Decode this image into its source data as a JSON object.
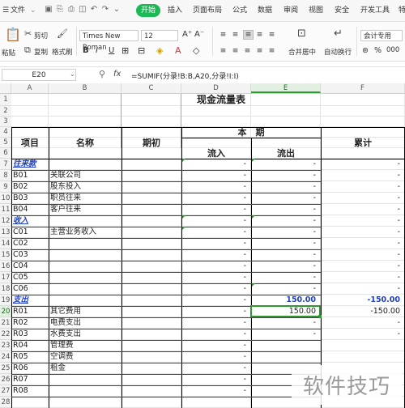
{
  "menu": {
    "file_label": "文件",
    "tabs": [
      "开始",
      "插入",
      "页面布局",
      "公式",
      "数据",
      "审阅",
      "视图",
      "安全",
      "开发工具",
      "特"
    ]
  },
  "ribbon": {
    "paste": "粘贴",
    "cut": "剪切",
    "copy": "复制",
    "format_painter": "格式刷",
    "font_name": "Times New Roman",
    "font_size": "12",
    "merge_center": "合并居中",
    "wrap_text": "自动换行",
    "number_format": "会计专用",
    "percent": "%",
    "thousands": "000"
  },
  "formula_bar": {
    "cell_ref": "E20",
    "fx": "fx",
    "formula": "=SUMIF(分录!B:B,A20,分录!I:I)"
  },
  "columns": [
    "A",
    "B",
    "C",
    "D",
    "E",
    "F"
  ],
  "selected_column": "E",
  "rows": [
    "1",
    "2",
    "3",
    "4",
    "5",
    "6",
    "7",
    "8",
    "9",
    "10",
    "11",
    "12",
    "13",
    "14",
    "15",
    "16",
    "17",
    "18",
    "19",
    "20",
    "21",
    "22",
    "23",
    "24",
    "25",
    "26",
    "27",
    "28"
  ],
  "selected_row": "20",
  "sheet": {
    "title": "现金流量表",
    "header": {
      "item": "项目",
      "name": "名称",
      "opening": "期初",
      "current_period": "本　期",
      "inflow": "流入",
      "outflow": "流出",
      "cumulative": "累计"
    },
    "data_rows": [
      {
        "code": "往来款",
        "name": "",
        "section": true,
        "d": "-",
        "e": "-",
        "f": "-"
      },
      {
        "code": "B01",
        "name": "关联公司",
        "d": "-",
        "e": "-",
        "f": "-"
      },
      {
        "code": "B02",
        "name": "股东投入",
        "d": "-",
        "e": "-",
        "f": "-"
      },
      {
        "code": "B03",
        "name": "职员往来",
        "d": "-",
        "e": "-",
        "f": "-"
      },
      {
        "code": "B04",
        "name": "客户往来",
        "d": "-",
        "e": "-",
        "f": "-"
      },
      {
        "code": "收入",
        "name": "",
        "section": true,
        "d": "-",
        "e": "-",
        "f": "-"
      },
      {
        "code": "C01",
        "name": "主营业务收入",
        "d": "-",
        "e": "-",
        "f": "-"
      },
      {
        "code": "C02",
        "name": "",
        "d": "-",
        "e": "-",
        "f": "-"
      },
      {
        "code": "C03",
        "name": "",
        "d": "-",
        "e": "-",
        "f": "-"
      },
      {
        "code": "C04",
        "name": "",
        "d": "-",
        "e": "-",
        "f": "-"
      },
      {
        "code": "C05",
        "name": "",
        "d": "-",
        "e": "-",
        "f": "-"
      },
      {
        "code": "C06",
        "name": "",
        "d": "-",
        "e": "-",
        "f": "-"
      },
      {
        "code": "支出",
        "name": "",
        "section": true,
        "d": "-",
        "e": "150.00",
        "f": "-150.00"
      },
      {
        "code": "R01",
        "name": "其它费用",
        "d": "-",
        "e": "150.00",
        "f": "-150.00"
      },
      {
        "code": "R02",
        "name": "电费支出",
        "d": "-",
        "e": "-",
        "f": "-"
      },
      {
        "code": "R03",
        "name": "水费支出",
        "d": "-",
        "e": "-",
        "f": "-"
      },
      {
        "code": "R04",
        "name": "管理费",
        "d": "-",
        "e": "",
        "f": ""
      },
      {
        "code": "R05",
        "name": "空调费",
        "d": "-",
        "e": "",
        "f": ""
      },
      {
        "code": "R06",
        "name": "租金",
        "d": "-",
        "e": "",
        "f": ""
      },
      {
        "code": "R07",
        "name": "",
        "d": "-",
        "e": "",
        "f": ""
      },
      {
        "code": "R08",
        "name": "",
        "d": "-",
        "e": "",
        "f": ""
      }
    ]
  },
  "watermark": "软件技巧",
  "colors": {
    "accent": "#1db954",
    "section_blue": "#1f3fbf",
    "selection": "#2e9a2e"
  }
}
